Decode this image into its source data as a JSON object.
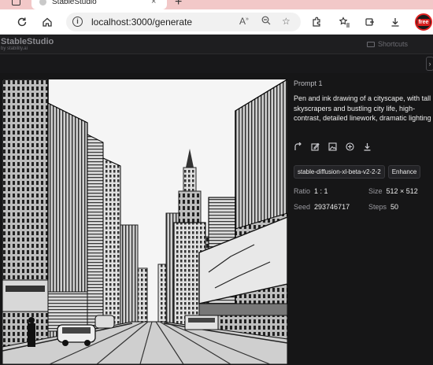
{
  "browser": {
    "tab_title": "StableStudio",
    "tab_close": "×",
    "new_tab": "+",
    "url": "localhost:3000/generate",
    "profile_badge": "free"
  },
  "app": {
    "brand": "StableStudio",
    "brand_sub": "by stability.ai",
    "shortcuts_label": "Shortcuts",
    "collapse_glyph": "›"
  },
  "sidebar": {
    "prompt_label": "Prompt 1",
    "prompt_text": "Pen and ink drawing of a cityscape, with tall skyscrapers and bustling city life, high-contrast, detailed linework, dramatic lighting",
    "model_tag": "stable-diffusion-xl-beta-v2-2-2",
    "enhance_label": "Enhance",
    "ratio_label": "Ratio",
    "ratio_value": "1 : 1",
    "size_label": "Size",
    "size_value": "512 × 512",
    "seed_label": "Seed",
    "seed_value": "293746717",
    "steps_label": "Steps",
    "steps_value": "50"
  }
}
